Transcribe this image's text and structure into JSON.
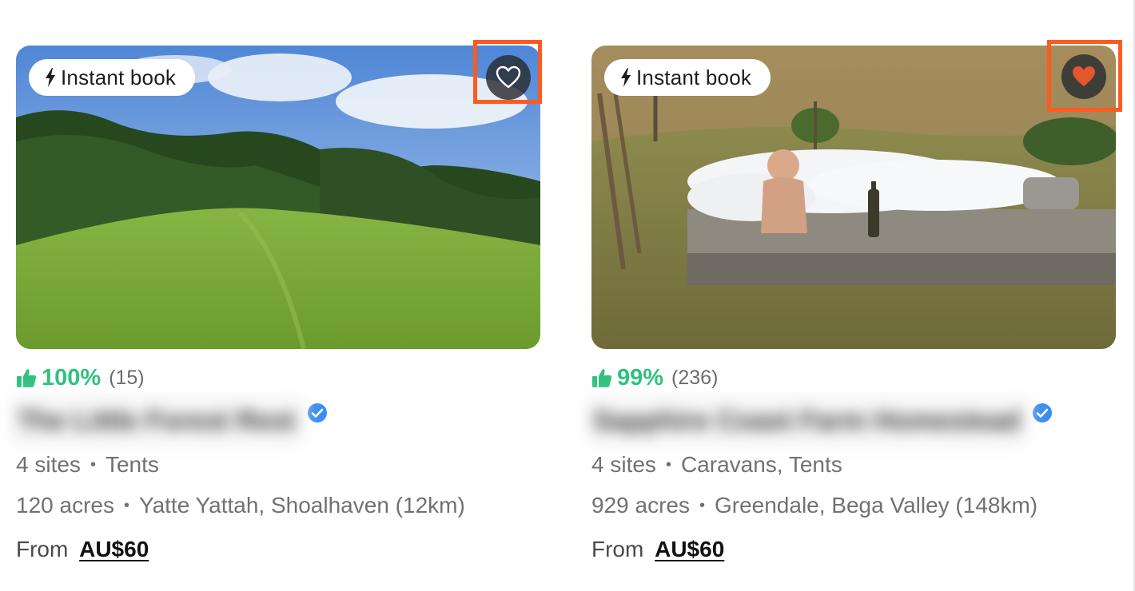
{
  "listings": [
    {
      "badge": "Instant book",
      "favourited": false,
      "rating_percent": "100%",
      "rating_count": "(15)",
      "name": "The Little Forest Rest",
      "sites": "4 sites",
      "types": "Tents",
      "acres": "120 acres",
      "location": "Yatte Yattah, Shoalhaven (12km)",
      "price_prefix": "From",
      "price": "AU$60"
    },
    {
      "badge": "Instant book",
      "favourited": true,
      "rating_percent": "99%",
      "rating_count": "(236)",
      "name": "Sapphire Coast Farm Homestead",
      "sites": "4 sites",
      "types": "Caravans, Tents",
      "acres": "929 acres",
      "location": "Greendale, Bega Valley (148km)",
      "price_prefix": "From",
      "price": "AU$60"
    }
  ],
  "icons": {
    "badge": "lightning-bolt-icon",
    "favourite_off": "heart-outline-icon",
    "favourite_on": "heart-filled-icon",
    "rating": "thumbs-up-icon",
    "verified": "verified-check-icon"
  },
  "colors": {
    "rating_green": "#2ec27e",
    "heart_filled": "#e2572b",
    "highlight": "#ff5a1f",
    "verified_blue": "#3b8ef0"
  }
}
